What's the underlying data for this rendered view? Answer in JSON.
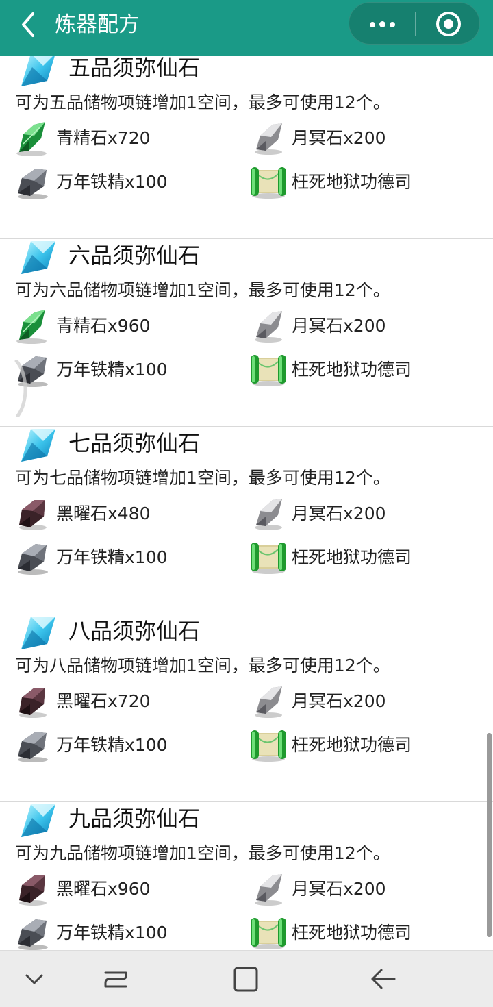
{
  "header": {
    "title": "炼器配方",
    "bg_color": "#1a9a87"
  },
  "recipes": [
    {
      "title": "五品须弥仙石",
      "desc": "可为五品储物项链增加1空间，最多可使用12个。",
      "materials": [
        {
          "label": "青精石x720",
          "icon": "green-crystal-icon"
        },
        {
          "label": "月冥石x200",
          "icon": "silver-stone-icon"
        },
        {
          "label": "万年铁精x100",
          "icon": "iron-ore-icon"
        },
        {
          "label": "枉死地狱功德司",
          "icon": "scroll-icon"
        }
      ]
    },
    {
      "title": "六品须弥仙石",
      "desc": "可为六品储物项链增加1空间，最多可使用12个。",
      "materials": [
        {
          "label": "青精石x960",
          "icon": "green-crystal-icon"
        },
        {
          "label": "月冥石x200",
          "icon": "silver-stone-icon"
        },
        {
          "label": "万年铁精x100",
          "icon": "iron-ore-icon"
        },
        {
          "label": "枉死地狱功德司",
          "icon": "scroll-icon"
        }
      ]
    },
    {
      "title": "七品须弥仙石",
      "desc": "可为七品储物项链增加1空间，最多可使用12个。",
      "materials": [
        {
          "label": "黑曜石x480",
          "icon": "obsidian-icon"
        },
        {
          "label": "月冥石x200",
          "icon": "silver-stone-icon"
        },
        {
          "label": "万年铁精x100",
          "icon": "iron-ore-icon"
        },
        {
          "label": "枉死地狱功德司",
          "icon": "scroll-icon"
        }
      ]
    },
    {
      "title": "八品须弥仙石",
      "desc": "可为八品储物项链增加1空间，最多可使用12个。",
      "materials": [
        {
          "label": "黑曜石x720",
          "icon": "obsidian-icon"
        },
        {
          "label": "月冥石x200",
          "icon": "silver-stone-icon"
        },
        {
          "label": "万年铁精x100",
          "icon": "iron-ore-icon"
        },
        {
          "label": "枉死地狱功德司",
          "icon": "scroll-icon"
        }
      ]
    },
    {
      "title": "九品须弥仙石",
      "desc": "可为九品储物项链增加1空间，最多可使用12个。",
      "materials": [
        {
          "label": "黑曜石x960",
          "icon": "obsidian-icon"
        },
        {
          "label": "月冥石x200",
          "icon": "silver-stone-icon"
        },
        {
          "label": "万年铁精x100",
          "icon": "iron-ore-icon"
        },
        {
          "label": "枉死地狱功德司",
          "icon": "scroll-icon"
        }
      ]
    }
  ],
  "navbar": {
    "icons": [
      "chevron-down-icon",
      "recent-apps-icon",
      "home-icon",
      "back-arrow-icon"
    ]
  }
}
